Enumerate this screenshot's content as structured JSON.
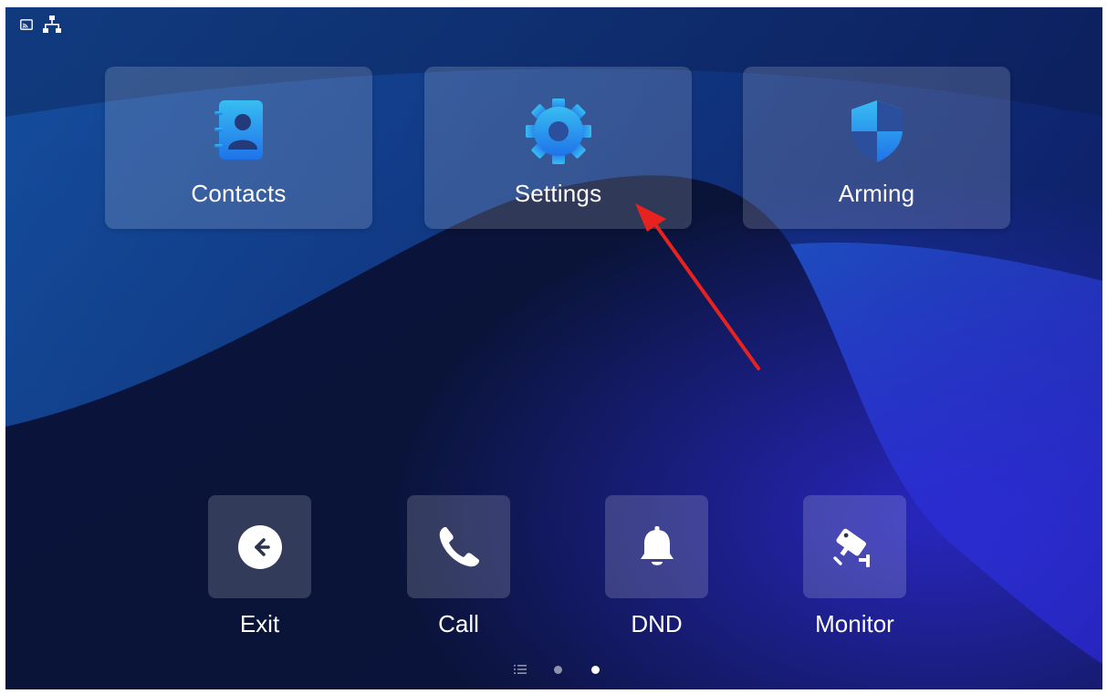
{
  "status_bar": {
    "icons": [
      "cast-icon",
      "network-icon"
    ]
  },
  "apps": [
    {
      "label": "Contacts",
      "icon": "contacts-book-icon"
    },
    {
      "label": "Settings",
      "icon": "gear-icon"
    },
    {
      "label": "Arming",
      "icon": "shield-icon"
    }
  ],
  "dock": [
    {
      "label": "Exit",
      "icon": "arrow-left-circle-icon"
    },
    {
      "label": "Call",
      "icon": "phone-icon"
    },
    {
      "label": "DND",
      "icon": "bell-icon"
    },
    {
      "label": "Monitor",
      "icon": "security-camera-icon"
    }
  ],
  "pager": {
    "pages": 2,
    "active_page": 2,
    "items": [
      "list-icon",
      "page-1-dot",
      "page-2-dot"
    ]
  },
  "annotation": {
    "type": "red-arrow",
    "target": "Settings",
    "color": "#e8231f"
  },
  "colors": {
    "icon_gradient_top": "#36b9f0",
    "icon_gradient_bottom": "#1e6fe8",
    "tile_background": "rgba(255,255,255,0.16)",
    "wallpaper_base": "#0b1330",
    "wallpaper_wave": "#1c5fc4"
  }
}
